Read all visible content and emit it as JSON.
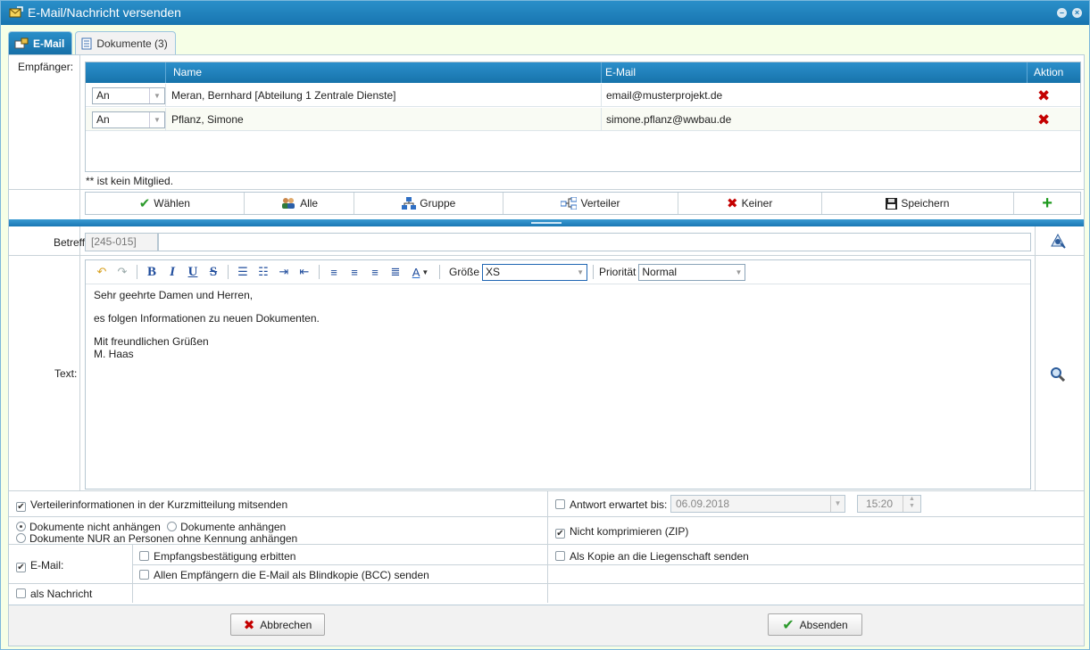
{
  "window": {
    "title": "E-Mail/Nachricht versenden"
  },
  "tabs": [
    {
      "label": "E-Mail"
    },
    {
      "label": "Dokumente (3)"
    }
  ],
  "recipients": {
    "label": "Empfänger:",
    "columns": {
      "name": "Name",
      "email": "E-Mail",
      "action": "Aktion"
    },
    "rows": [
      {
        "type": "An",
        "name": "Meran, Bernhard [Abteilung 1 Zentrale Dienste]",
        "email": "email@musterprojekt.de"
      },
      {
        "type": "An",
        "name": "Pflanz, Simone",
        "email": "simone.pflanz@wwbau.de"
      }
    ],
    "note": "** ist kein Mitglied."
  },
  "buttons": {
    "choose": "Wählen",
    "all": "Alle",
    "group": "Gruppe",
    "distribution": "Verteiler",
    "none": "Keiner",
    "save": "Speichern",
    "add": "+"
  },
  "subject": {
    "label": "Betreff:",
    "prefix": "[245-015]",
    "value": ""
  },
  "text": {
    "label": "Text:",
    "size_label": "Größe",
    "size_value": "XS",
    "priority_label": "Priorität",
    "priority_value": "Normal",
    "body": {
      "line1": "Sehr geehrte Damen und Herren,",
      "line2": "es folgen Informationen zu neuen Dokumenten.",
      "line3": "Mit freundlichen Grüßen",
      "line4": "M. Haas"
    }
  },
  "options": {
    "distribution_info": "Verteilerinformationen in der Kurzmitteilung mitsenden",
    "reply_expected": "Antwort erwartet bis:",
    "reply_date": "06.09.2018",
    "reply_time": "15:20",
    "radio_no_attach": "Dokumente nicht anhängen",
    "radio_attach": "Dokumente anhängen",
    "radio_only_no_id": "Dokumente NUR an Personen ohne Kennung anhängen",
    "no_compress": "Nicht komprimieren (ZIP)",
    "email": "E-Mail:",
    "receipt": "Empfangsbestätigung erbitten",
    "copy_property": "Als Kopie an die Liegenschaft senden",
    "bcc": "Allen Empfängern die E-Mail als Blindkopie (BCC) senden",
    "as_message": "als Nachricht"
  },
  "footer": {
    "cancel": "Abbrechen",
    "send": "Absenden"
  }
}
